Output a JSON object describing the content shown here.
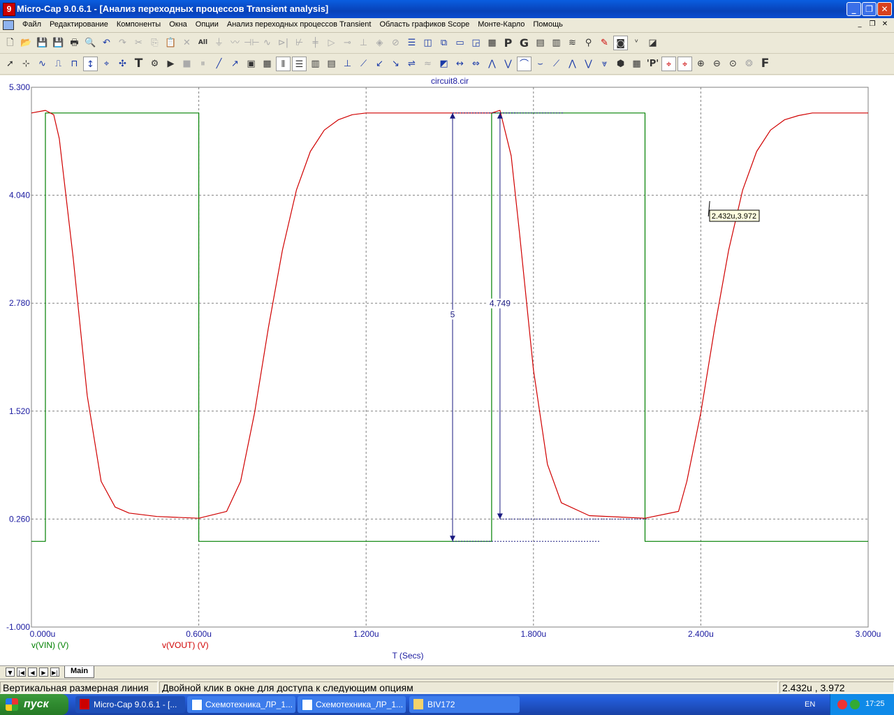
{
  "window": {
    "title": "Micro-Cap 9.0.6.1 - [Анализ переходных процессов Transient analysis]",
    "app_icon_letter": "9"
  },
  "menu": [
    "Файл",
    "Редактирование",
    "Компоненты",
    "Окна",
    "Опции",
    "Анализ переходных процессов Transient",
    "Область графиков Scope",
    "Монте-Карло",
    "Помощь"
  ],
  "toolbar1_icons": [
    "new-file",
    "open",
    "save",
    "save-as",
    "print",
    "print-preview",
    "undo",
    "redo",
    "cut",
    "copy",
    "paste",
    "delete",
    "select-all-text",
    "ground",
    "resistor",
    "capacitor",
    "inductor",
    "diode",
    "npn",
    "capacitor-alt",
    "buffer",
    "switch",
    "battery",
    "node",
    "source",
    "window-split-h",
    "window-split-v",
    "cascade",
    "maximize-window",
    "tile",
    "calculator",
    "text-P",
    "text-G",
    "table",
    "grid-settings",
    "waveform",
    "probe",
    "pen",
    "scope",
    "vd",
    "zoom-rect"
  ],
  "toolbar1_labels": {
    "select_all": "All",
    "p": "P",
    "g": "G"
  },
  "toolbar2_labels": {
    "text_tool": "T",
    "p_tool": "'P'",
    "f_tool": "F"
  },
  "chart_data": {
    "type": "line",
    "title": "circuit8.cir",
    "xlabel": "T (Secs)",
    "x_unit": "u",
    "xlim": [
      0,
      3.0
    ],
    "ylim": [
      -1.0,
      5.3
    ],
    "x_ticks": [
      "0.000u",
      "0.600u",
      "1.200u",
      "1.800u",
      "2.400u",
      "3.000u"
    ],
    "y_ticks": [
      "5.300",
      "4.040",
      "2.780",
      "1.520",
      "0.260",
      "-1.000"
    ],
    "grid": true,
    "series": [
      {
        "name": "v(VIN) (V)",
        "color": "#008000",
        "x": [
          0,
          0.05,
          0.05,
          0.6,
          0.6,
          1.65,
          1.65,
          2.2,
          2.2,
          3.0
        ],
        "y": [
          0,
          0,
          5,
          5,
          0,
          0,
          5,
          5,
          0,
          0
        ]
      },
      {
        "name": "v(VOUT) (V)",
        "color": "#d00000",
        "x": [
          0,
          0.05,
          0.08,
          0.1,
          0.15,
          0.2,
          0.25,
          0.3,
          0.35,
          0.45,
          0.6,
          0.7,
          0.75,
          0.8,
          0.85,
          0.9,
          0.95,
          1.0,
          1.05,
          1.1,
          1.15,
          1.2,
          1.3,
          1.65,
          1.68,
          1.72,
          1.75,
          1.8,
          1.85,
          1.9,
          2.0,
          2.2,
          2.32,
          2.35,
          2.4,
          2.45,
          2.5,
          2.55,
          2.6,
          2.65,
          2.7,
          2.75,
          2.8,
          2.9,
          3.0
        ],
        "y": [
          5.0,
          5.03,
          4.98,
          4.7,
          3.3,
          1.7,
          0.7,
          0.4,
          0.33,
          0.29,
          0.27,
          0.35,
          0.7,
          1.5,
          2.5,
          3.4,
          4.1,
          4.55,
          4.8,
          4.92,
          4.98,
          5.0,
          5.0,
          5.0,
          5.03,
          4.5,
          3.6,
          2.0,
          0.9,
          0.45,
          0.3,
          0.27,
          0.35,
          0.7,
          1.5,
          2.5,
          3.4,
          4.1,
          4.55,
          4.8,
          4.92,
          4.97,
          5.0,
          5.0,
          5.0
        ]
      }
    ],
    "annotations": [
      {
        "label": "5",
        "x": 1.51,
        "y_from": 0,
        "y_to": 5,
        "kind": "dimension"
      },
      {
        "label": "4.749",
        "x": 1.68,
        "y_from": 0.26,
        "y_to": 5.0,
        "kind": "dimension"
      },
      {
        "label": "2.432u,3.972",
        "x": 2.432,
        "y": 3.972,
        "kind": "tag"
      }
    ]
  },
  "tabs": {
    "main": "Main"
  },
  "status": {
    "left": "Вертикальная размерная линия",
    "middle": "Двойной клик в окне для доступа к следующим опциям",
    "right": "2.432u , 3.972"
  },
  "taskbar": {
    "start": "пуск",
    "tasks": [
      "Micro-Cap 9.0.6.1 - [...",
      "Схемотехника_ЛР_1...",
      "Схемотехника_ЛР_1...",
      "BIV172"
    ],
    "lang": "EN",
    "time": "17:25"
  }
}
